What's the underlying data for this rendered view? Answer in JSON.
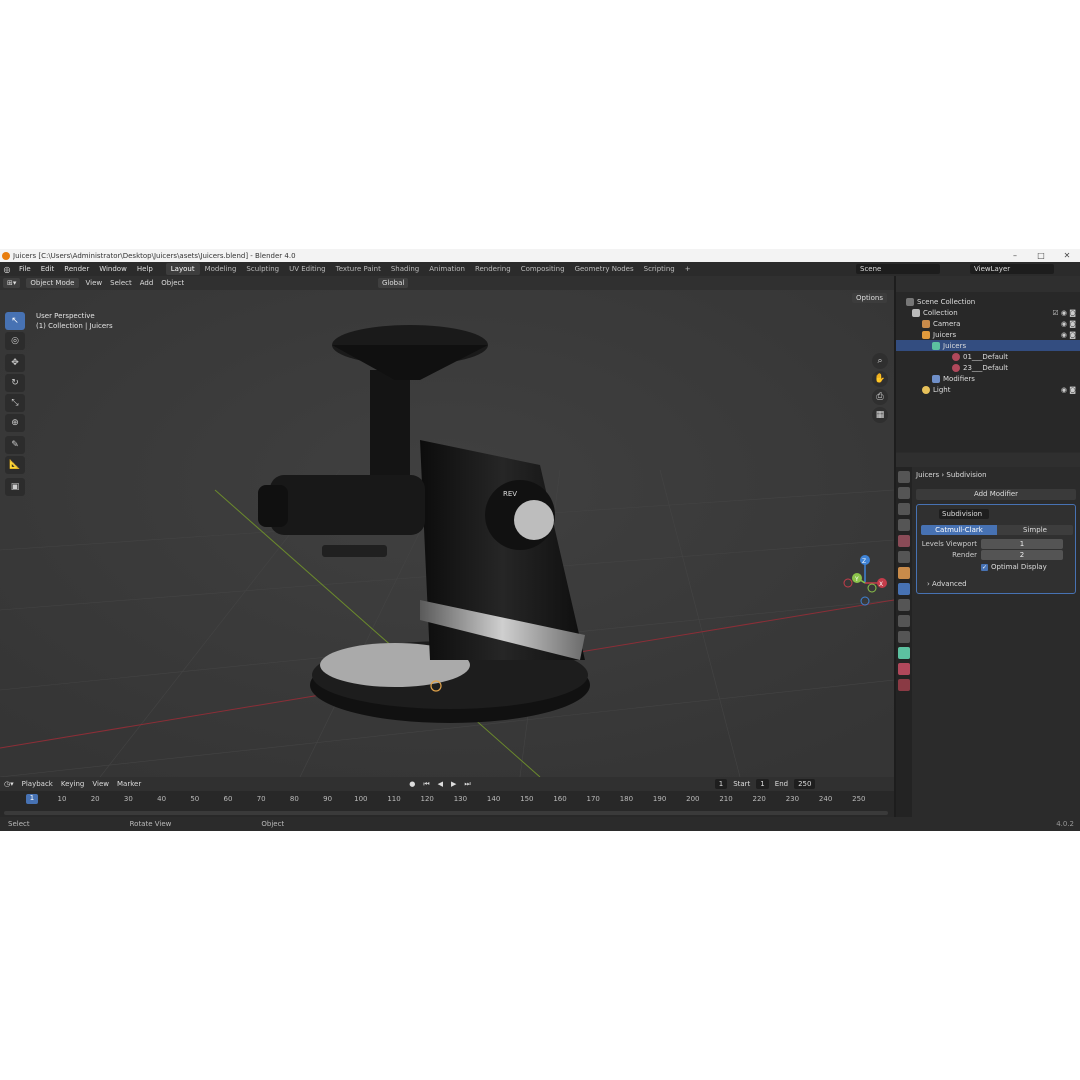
{
  "window": {
    "title": "Juicers [C:\\Users\\Administrator\\Desktop\\Juicers\\asets\\Juicers.blend] - Blender 4.0",
    "minimize": "–",
    "maximize": "□",
    "close": "✕"
  },
  "menu": [
    "File",
    "Edit",
    "Render",
    "Window",
    "Help"
  ],
  "workspaces": [
    "Layout",
    "Modeling",
    "Sculpting",
    "UV Editing",
    "Texture Paint",
    "Shading",
    "Animation",
    "Rendering",
    "Compositing",
    "Geometry Nodes",
    "Scripting"
  ],
  "active_workspace": "Layout",
  "scene": "Scene",
  "view_layer": "ViewLayer",
  "header": {
    "mode": "Object Mode",
    "items": [
      "View",
      "Select",
      "Add",
      "Object"
    ],
    "transform": "Global",
    "options": "Options"
  },
  "viewport": {
    "perspective": "User Perspective",
    "collection": "(1) Collection | Juicers",
    "knob_label": "REV"
  },
  "gizmo": {
    "x": "X",
    "y": "Y",
    "z": "Z"
  },
  "timeline": {
    "menu": [
      "Playback",
      "Keying",
      "View",
      "Marker"
    ],
    "current_frame": "1",
    "start_label": "Start",
    "start": "1",
    "end_label": "End",
    "end": "250",
    "ticks": [
      "10",
      "20",
      "30",
      "40",
      "50",
      "60",
      "70",
      "80",
      "90",
      "100",
      "110",
      "120",
      "130",
      "140",
      "150",
      "160",
      "170",
      "180",
      "190",
      "200",
      "210",
      "220",
      "230",
      "240",
      "250"
    ]
  },
  "status": {
    "select": "Select",
    "rotate": "Rotate View",
    "object": "Object",
    "version": "4.0.2"
  },
  "outliner": {
    "rows": [
      {
        "label": "Scene Collection"
      },
      {
        "label": "Collection"
      },
      {
        "label": "Camera"
      },
      {
        "label": "Juicers"
      },
      {
        "label": "Juicers"
      },
      {
        "label": "01___Default"
      },
      {
        "label": "23___Default"
      },
      {
        "label": "Modifiers"
      },
      {
        "label": "Light"
      }
    ]
  },
  "properties": {
    "object": "Juicers",
    "modifier_tab": "Subdivision",
    "add_modifier": "Add Modifier",
    "modifier_name": "Subdivision",
    "seg_catmull": "Catmull-Clark",
    "seg_simple": "Simple",
    "levels_label": "Levels Viewport",
    "levels_value": "1",
    "render_label": "Render",
    "render_value": "2",
    "optimal": "Optimal Display",
    "advanced": "Advanced"
  },
  "colors": {
    "accent": "#4772b3",
    "x_axis": "#c43c4a",
    "y_axis": "#8bc34a",
    "z_axis": "#3f83d6"
  }
}
